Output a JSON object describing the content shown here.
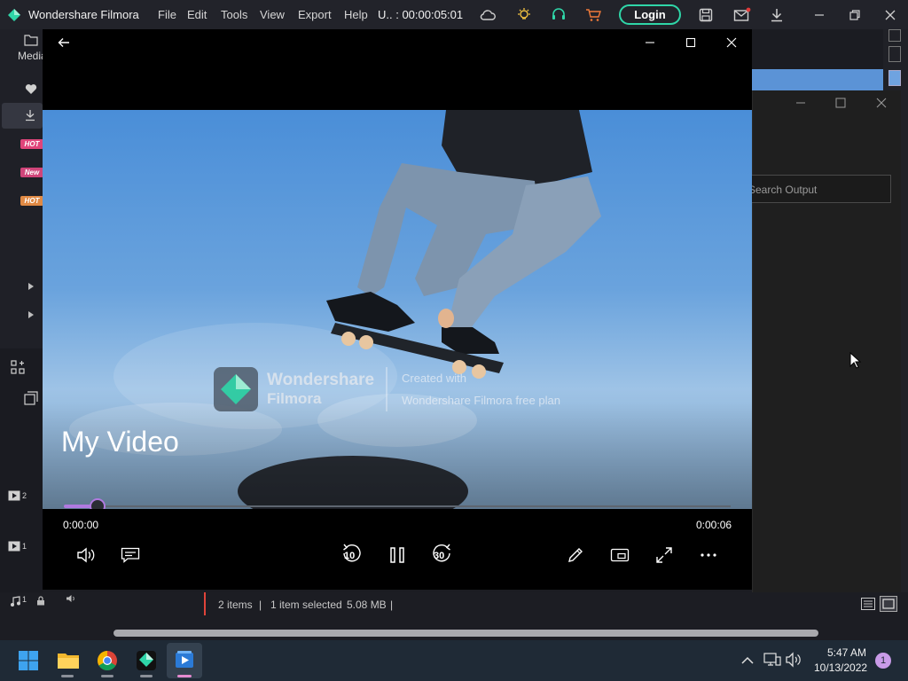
{
  "app": {
    "title": "Wondershare Filmora",
    "menu": [
      "File",
      "Edit",
      "Tools",
      "View",
      "Export",
      "Help"
    ],
    "timer": "U.. : 00:00:05:01",
    "login": "Login"
  },
  "sidebar": {
    "media_label": "Media",
    "badges": [
      "HOT",
      "New",
      "HOT"
    ]
  },
  "timeline": {
    "track_video_2": "2",
    "track_video_1": "1",
    "track_audio_1": "1"
  },
  "explorer_status": {
    "items": "2 items",
    "sep": "|",
    "selected": "1 item selected",
    "size": "5.08 MB"
  },
  "output_window": {
    "search_placeholder": "Search Output"
  },
  "player": {
    "video_title": "My Video",
    "watermark_brand_line1": "Wondershare",
    "watermark_brand_line2": "Filmora",
    "watermark_note_line1": "Created with",
    "watermark_note_line2": "Wondershare Filmora free plan",
    "time_current": "0:00:00",
    "time_total": "0:00:06",
    "skip_back": "10",
    "skip_forward": "30",
    "progress": 0.05
  },
  "taskbar": {
    "time": "5:47 AM",
    "date": "10/13/2022",
    "notifications": "1"
  },
  "colors": {
    "accent": "#2fd6a8",
    "progress": "#b07ae0",
    "hot_badge": "#e0457a",
    "new_badge": "#d0457a"
  }
}
